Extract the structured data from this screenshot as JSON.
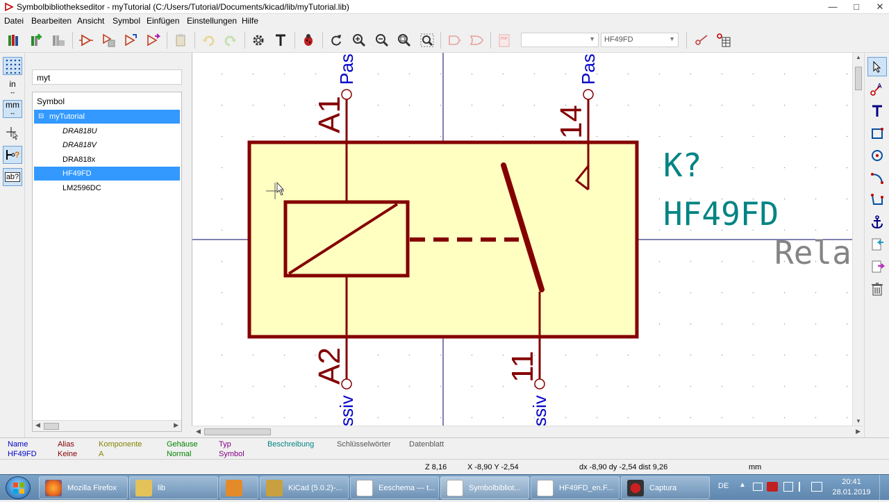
{
  "window": {
    "title": "Symbolbibliothekseditor - myTutorial (C:/Users/Tutorial/Documents/kicad/lib/myTutorial.lib)",
    "controls": [
      "—",
      "□",
      "✕"
    ]
  },
  "menu": [
    "Datei",
    "Bearbeiten",
    "Ansicht",
    "Symbol",
    "Einfügen",
    "Einstellungen",
    "Hilfe"
  ],
  "toolbar": {
    "unit_combo_value": "",
    "part_combo_value": "HF49FD"
  },
  "lefttoolbar": {
    "units_in": "in",
    "units_mm": "mm",
    "text_label": "ab?"
  },
  "library": {
    "search_value": "myt",
    "tree_header": "Symbol",
    "library_name": "myTutorial",
    "expander": "⊟",
    "items": [
      {
        "name": "DRA818U",
        "italic": true
      },
      {
        "name": "DRA818V",
        "italic": true
      },
      {
        "name": "DRA818x",
        "italic": false
      },
      {
        "name": "HF49FD",
        "italic": false,
        "selected": true
      },
      {
        "name": "LM2596DC",
        "italic": false
      }
    ]
  },
  "schematic": {
    "pin_a1_number": "A1",
    "pin_a2_number": "A2",
    "pin_14_number": "14",
    "pin_11_number": "11",
    "pin_a1_type": "Pas",
    "pin_14_type": "Pas",
    "pin_a2_type": "ssiv",
    "pin_11_type": "ssiv",
    "reference": "K?",
    "value": "HF49FD",
    "footprint_partial": "Rela",
    "colors": {
      "body_fill": "#ffffc2",
      "body_stroke": "#840000",
      "field_color": "#008484",
      "pin_name_color": "#0000c8",
      "gray_text": "#848484"
    }
  },
  "message_panel": [
    {
      "label": "Name",
      "value": "HF49FD",
      "color": "#0000c8"
    },
    {
      "label": "Alias",
      "value": "Keine",
      "color": "#840000"
    },
    {
      "label": "Komponente",
      "value": "A",
      "color": "#848400"
    },
    {
      "label": "Gehäuse",
      "value": "Normal",
      "color": "#008400"
    },
    {
      "label": "Typ",
      "value": "Symbol",
      "color": "#840084"
    },
    {
      "label": "Beschreibung",
      "value": "",
      "color": "#008484"
    },
    {
      "label": "Schlüsselwörter",
      "value": "",
      "color": "#555555"
    },
    {
      "label": "Datenblatt",
      "value": "",
      "color": "#555555"
    }
  ],
  "status": {
    "zoom": "Z 8,16",
    "xy": "X -8,90  Y -2,54",
    "delta": "dx -8,90  dy -2,54  dist 9,26",
    "units": "mm"
  },
  "taskbar": {
    "apps": [
      {
        "label": "Mozilla Firefox",
        "color": "#e8661a"
      },
      {
        "label": "lib",
        "color": "#e3c25a"
      },
      {
        "label": "",
        "color": "#e38a2a"
      },
      {
        "label": "KiCad (5.0.2)-...",
        "color": "#c8a040"
      },
      {
        "label": "Eeschema — t...",
        "color": "#b05030"
      },
      {
        "label": "Symbolbibliot...",
        "color": "#c02030"
      },
      {
        "label": "HF49FD_en.F...",
        "color": "#ffffff"
      },
      {
        "label": "Captura",
        "color": "#cc2020"
      }
    ],
    "lang": "DE",
    "time": "20:41",
    "date": "28.01.2019"
  }
}
